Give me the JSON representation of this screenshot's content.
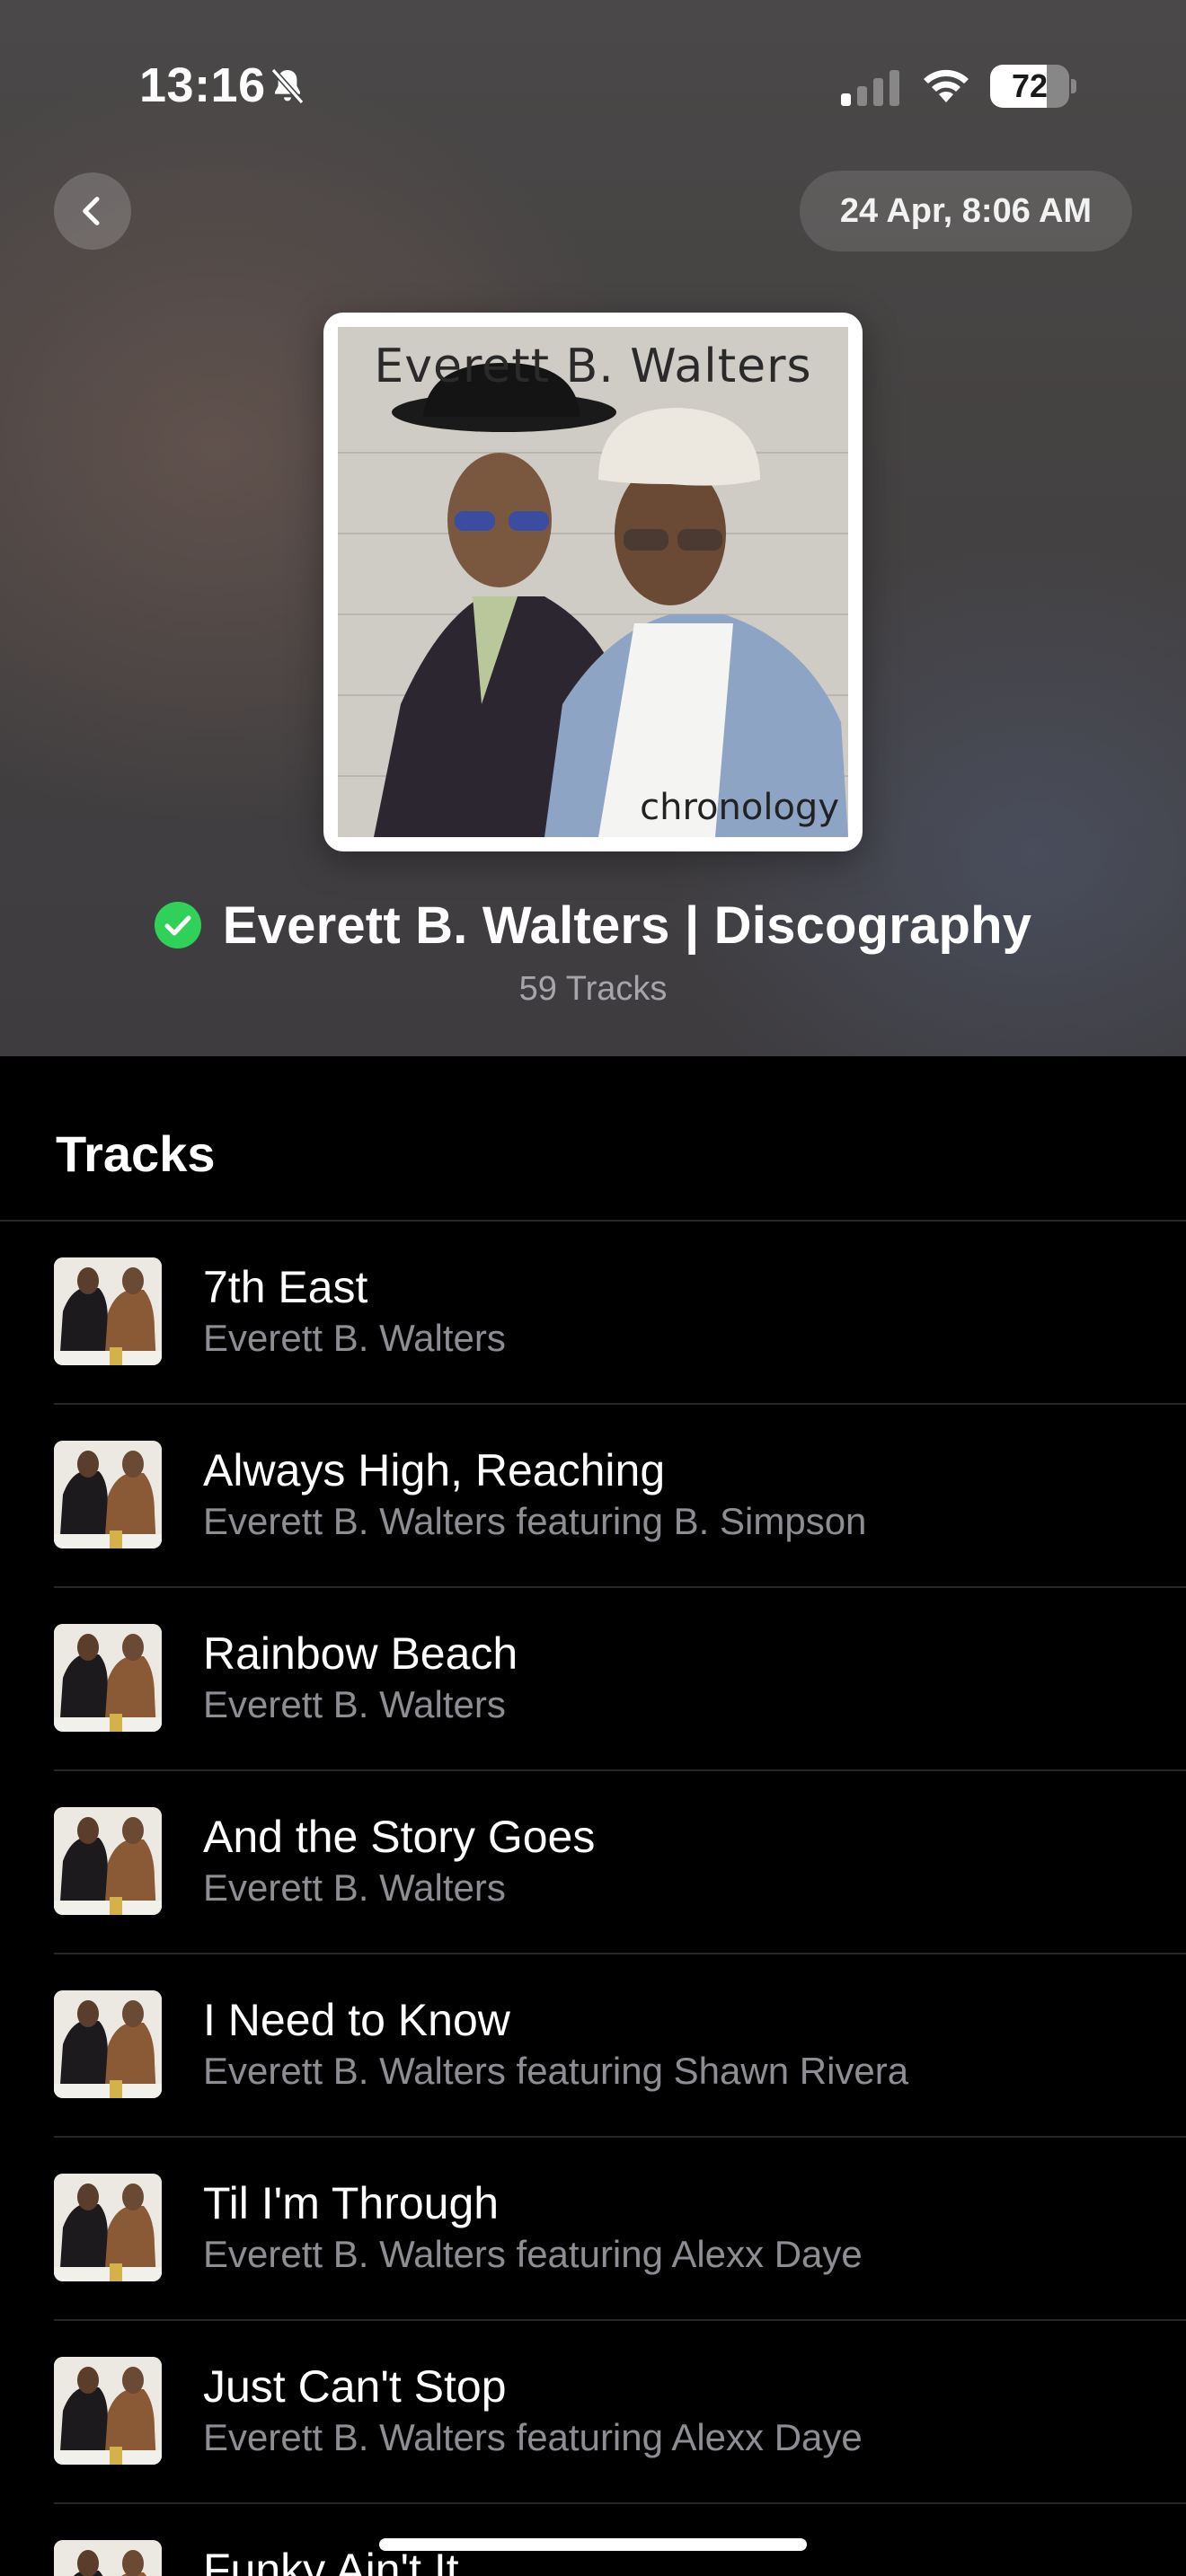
{
  "status_bar": {
    "time": "13:16",
    "battery_level": "72",
    "battery_fraction": 0.72,
    "icons": [
      "bell-slash-icon",
      "cellular-signal-icon",
      "wifi-icon",
      "battery-icon"
    ]
  },
  "nav": {
    "back_icon": "chevron-left-icon",
    "date_label": "24 Apr, 8:06 AM"
  },
  "album": {
    "art_title": "Everett B. Walters",
    "art_subtitle": "chronology"
  },
  "playlist": {
    "title": "Everett B. Walters | Discography",
    "verified_icon": "checkmark-circle-icon",
    "verified_color": "#30d158",
    "track_count": "59 Tracks"
  },
  "tracks_section": {
    "heading": "Tracks",
    "items": [
      {
        "title": "7th East",
        "artist": "Everett B. Walters"
      },
      {
        "title": "Always High, Reaching",
        "artist": "Everett B. Walters featuring B. Simpson"
      },
      {
        "title": "Rainbow Beach",
        "artist": "Everett B. Walters"
      },
      {
        "title": "And the Story Goes",
        "artist": "Everett B. Walters"
      },
      {
        "title": "I Need to Know",
        "artist": "Everett B. Walters featuring Shawn Rivera"
      },
      {
        "title": "Til I'm Through",
        "artist": "Everett B. Walters featuring Alexx Daye"
      },
      {
        "title": "Just Can't Stop",
        "artist": "Everett B. Walters featuring Alexx Daye"
      },
      {
        "title": "Funky Ain't It",
        "artist": ""
      }
    ]
  }
}
